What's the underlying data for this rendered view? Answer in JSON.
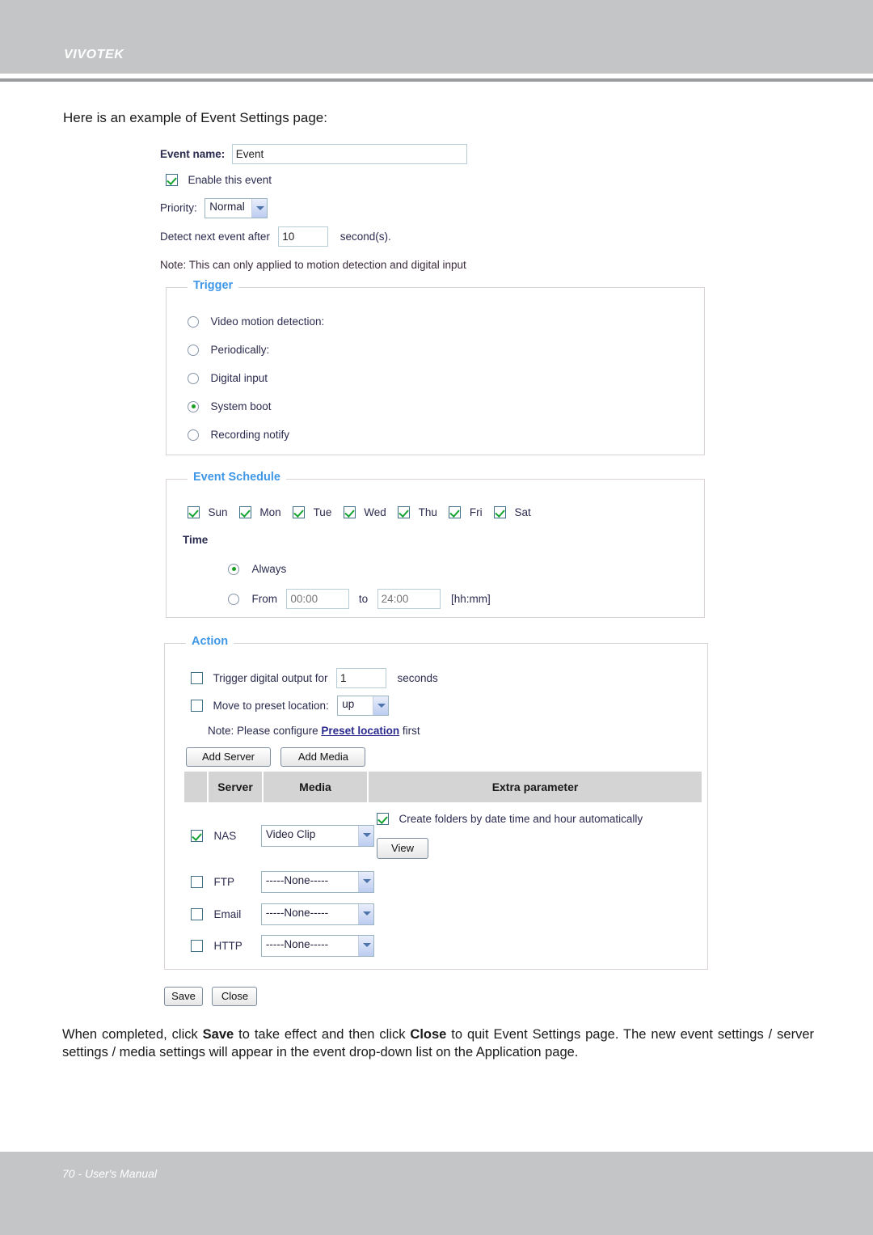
{
  "header": {
    "logo": "VIVOTEK"
  },
  "footer": {
    "text": "70 - User's Manual"
  },
  "intro": "Here is an example of Event Settings page:",
  "outro": {
    "part1": "When completed, click ",
    "save": "Save",
    "part2": " to take effect and then click ",
    "close": "Close",
    "part3": " to quit Event Settings page. The new event settings / server settings / media settings will appear in the event drop-down list on the Application page."
  },
  "form": {
    "event_name_label": "Event name:",
    "event_name_value": "Event",
    "enable_event_label": "Enable this event",
    "priority_label": "Priority:",
    "priority_value": "Normal",
    "detect_next_label": "Detect next event after",
    "detect_next_value": "10",
    "detect_next_suffix": "second(s).",
    "note": "Note: This can only applied to motion detection and digital input"
  },
  "trigger": {
    "legend": "Trigger",
    "options": [
      {
        "label": "Video motion detection:",
        "selected": false
      },
      {
        "label": "Periodically:",
        "selected": false
      },
      {
        "label": "Digital input",
        "selected": false
      },
      {
        "label": "System boot",
        "selected": true
      },
      {
        "label": "Recording notify",
        "selected": false
      }
    ]
  },
  "schedule": {
    "legend": "Event Schedule",
    "days": [
      {
        "label": "Sun",
        "checked": true
      },
      {
        "label": "Mon",
        "checked": true
      },
      {
        "label": "Tue",
        "checked": true
      },
      {
        "label": "Wed",
        "checked": true
      },
      {
        "label": "Thu",
        "checked": true
      },
      {
        "label": "Fri",
        "checked": true
      },
      {
        "label": "Sat",
        "checked": true
      }
    ],
    "time_label": "Time",
    "always_label": "Always",
    "always_selected": true,
    "from_label": "From",
    "from_placeholder": "00:00",
    "to_label": "to",
    "to_placeholder": "24:00",
    "format_hint": "[hh:mm]"
  },
  "action": {
    "legend": "Action",
    "trigger_do_label_a": "Trigger digital output for",
    "trigger_do_value": "1",
    "trigger_do_label_b": "seconds",
    "trigger_do_checked": false,
    "preset_label": "Move to preset location:",
    "preset_value": "up",
    "preset_checked": false,
    "preset_note_a": "Note: Please configure ",
    "preset_note_link": "Preset location",
    "preset_note_b": " first",
    "add_server_label": "Add Server",
    "add_media_label": "Add Media",
    "table": {
      "headers": [
        "",
        "Server",
        "Media",
        "Extra parameter"
      ],
      "rows": [
        {
          "checked": true,
          "server": "NAS",
          "media": "Video Clip",
          "extra_checkbox_label": "Create folders by date time and hour automatically",
          "extra_checkbox_checked": true,
          "view_button": "View"
        },
        {
          "checked": false,
          "server": "FTP",
          "media": "-----None-----"
        },
        {
          "checked": false,
          "server": "Email",
          "media": "-----None-----"
        },
        {
          "checked": false,
          "server": "HTTP",
          "media": "-----None-----"
        }
      ]
    }
  },
  "buttons": {
    "save": "Save",
    "close": "Close"
  }
}
